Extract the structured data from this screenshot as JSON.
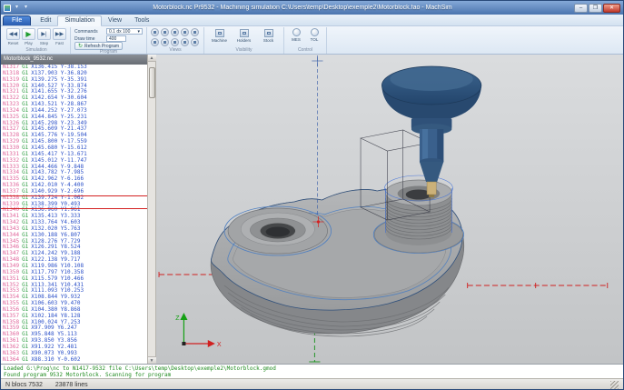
{
  "window": {
    "title": "Motorblock.nc  Pr9532 - Machining simulation  C:\\Users\\temp\\Desktop\\exemple2\\Motorblock.fao - MachSim",
    "controls": {
      "min": "–",
      "max": "❐",
      "close": "✕"
    }
  },
  "ribbon": {
    "file_button": "File",
    "tabs": [
      {
        "label": "Edit",
        "active": false
      },
      {
        "label": "Simulation",
        "active": true
      },
      {
        "label": "View",
        "active": false
      },
      {
        "label": "Tools",
        "active": false
      }
    ],
    "playback": {
      "group_label": "Simulation",
      "buttons": [
        {
          "name": "rewind",
          "glyph": "◀◀",
          "label": "Reset"
        },
        {
          "name": "play",
          "glyph": "▶",
          "label": "Play"
        },
        {
          "name": "step",
          "glyph": "▶|",
          "label": "Step"
        },
        {
          "name": "fast",
          "glyph": "▶▶",
          "label": "Fast"
        }
      ]
    },
    "program": {
      "group_label": "Program",
      "commands_label": "Commands",
      "commands_value": "0.1 dx 100",
      "dropdown_glyph": "▾",
      "draw_label": "Draw time",
      "draw_value": "400",
      "refresh_label": "Refresh Program",
      "refresh_glyph": "↻"
    },
    "views": {
      "group_label": "Views",
      "icons": [
        {
          "name": "iso"
        },
        {
          "name": "top"
        },
        {
          "name": "front"
        },
        {
          "name": "back"
        },
        {
          "name": "left"
        },
        {
          "name": "right"
        },
        {
          "name": "dimetric"
        },
        {
          "name": "trimetric"
        },
        {
          "name": "rotate"
        },
        {
          "name": "fit"
        }
      ]
    },
    "visibility": {
      "group_label": "Visibility",
      "buttons": [
        {
          "label": "Machine"
        },
        {
          "label": "Holders"
        },
        {
          "label": "Stock"
        }
      ]
    },
    "control": {
      "group_label": "Control",
      "buttons": [
        {
          "label": "MES"
        },
        {
          "label": "TOL"
        }
      ]
    }
  },
  "code_panel": {
    "header": "Motorblock_9532.nc",
    "marker_rows": [
      21,
      23
    ],
    "lines": [
      {
        "n": "N1317",
        "g": "G1",
        "c": "X136.415 Y-38.153"
      },
      {
        "n": "N1318",
        "g": "G1",
        "c": "X137.903 Y-36.820"
      },
      {
        "n": "N1319",
        "g": "G1",
        "c": "X139.275 Y-35.391"
      },
      {
        "n": "N1320",
        "g": "G1",
        "c": "X140.527 Y-33.874"
      },
      {
        "n": "N1321",
        "g": "G1",
        "c": "X141.655 Y-32.276"
      },
      {
        "n": "N1322",
        "g": "G1",
        "c": "X142.654 Y-30.604"
      },
      {
        "n": "N1323",
        "g": "G1",
        "c": "X143.521 Y-28.867"
      },
      {
        "n": "N1324",
        "g": "G1",
        "c": "X144.252 Y-27.073"
      },
      {
        "n": "N1325",
        "g": "G1",
        "c": "X144.845 Y-25.231"
      },
      {
        "n": "N1326",
        "g": "G1",
        "c": "X145.298 Y-23.349"
      },
      {
        "n": "N1327",
        "g": "G1",
        "c": "X145.609 Y-21.437"
      },
      {
        "n": "N1328",
        "g": "G1",
        "c": "X145.776 Y-19.504"
      },
      {
        "n": "N1329",
        "g": "G1",
        "c": "X145.800 Y-17.559"
      },
      {
        "n": "N1330",
        "g": "G1",
        "c": "X145.680 Y-15.612"
      },
      {
        "n": "N1331",
        "g": "G1",
        "c": "X145.417 Y-13.671"
      },
      {
        "n": "N1332",
        "g": "G1",
        "c": "X145.012 Y-11.747"
      },
      {
        "n": "N1333",
        "g": "G1",
        "c": "X144.466 Y-9.848"
      },
      {
        "n": "N1334",
        "g": "G1",
        "c": "X143.782 Y-7.985"
      },
      {
        "n": "N1335",
        "g": "G1",
        "c": "X142.962 Y-6.166"
      },
      {
        "n": "N1336",
        "g": "G1",
        "c": "X142.010 Y-4.400"
      },
      {
        "n": "N1337",
        "g": "G1",
        "c": "X140.929 Y-2.696"
      },
      {
        "n": "N1338",
        "g": "G1",
        "c": "X139.724 Y-1.062"
      },
      {
        "n": "N1339",
        "g": "G1",
        "c": "X138.399 Y0.493"
      },
      {
        "n": "N1340",
        "g": "G1",
        "c": "X136.960 Y1.961"
      },
      {
        "n": "N1341",
        "g": "G1",
        "c": "X135.413 Y3.333"
      },
      {
        "n": "N1342",
        "g": "G1",
        "c": "X133.764 Y4.603"
      },
      {
        "n": "N1343",
        "g": "G1",
        "c": "X132.020 Y5.763"
      },
      {
        "n": "N1344",
        "g": "G1",
        "c": "X130.188 Y6.807"
      },
      {
        "n": "N1345",
        "g": "G1",
        "c": "X128.276 Y7.729"
      },
      {
        "n": "N1346",
        "g": "G1",
        "c": "X126.291 Y8.524"
      },
      {
        "n": "N1347",
        "g": "G1",
        "c": "X124.242 Y9.188"
      },
      {
        "n": "N1348",
        "g": "G1",
        "c": "X122.138 Y9.717"
      },
      {
        "n": "N1349",
        "g": "G1",
        "c": "X119.986 Y10.108"
      },
      {
        "n": "N1350",
        "g": "G1",
        "c": "X117.797 Y10.358"
      },
      {
        "n": "N1351",
        "g": "G1",
        "c": "X115.579 Y10.466"
      },
      {
        "n": "N1352",
        "g": "G1",
        "c": "X113.341 Y10.431"
      },
      {
        "n": "N1353",
        "g": "G1",
        "c": "X111.093 Y10.253"
      },
      {
        "n": "N1354",
        "g": "G1",
        "c": "X108.844 Y9.932"
      },
      {
        "n": "N1355",
        "g": "G1",
        "c": "X106.603 Y9.470"
      },
      {
        "n": "N1356",
        "g": "G1",
        "c": "X104.380 Y8.868"
      },
      {
        "n": "N1357",
        "g": "G1",
        "c": "X102.184 Y8.128"
      },
      {
        "n": "N1358",
        "g": "G1",
        "c": "X100.024 Y7.253"
      },
      {
        "n": "N1359",
        "g": "G1",
        "c": "X97.909 Y6.247"
      },
      {
        "n": "N1360",
        "g": "G1",
        "c": "X95.848 Y5.113"
      },
      {
        "n": "N1361",
        "g": "G1",
        "c": "X93.850 Y3.856"
      },
      {
        "n": "N1362",
        "g": "G1",
        "c": "X91.922 Y2.481"
      },
      {
        "n": "N1363",
        "g": "G1",
        "c": "X90.073 Y0.993"
      },
      {
        "n": "N1364",
        "g": "G1",
        "c": "X88.310 Y-0.602"
      }
    ]
  },
  "viewport": {
    "axis_labels": {
      "z": "Z",
      "x": "X"
    }
  },
  "log": {
    "lines": [
      "Loaded G:\\Prog\\nc to N1417-9532 file C:\\Users\\temp\\Desktop\\exemple2\\Motorblock.gmod",
      "Found program 9532 Motorblock. Scanning for program"
    ]
  },
  "statusbar": {
    "blocks": "N blocs 7532",
    "lines": "23878 lines"
  }
}
